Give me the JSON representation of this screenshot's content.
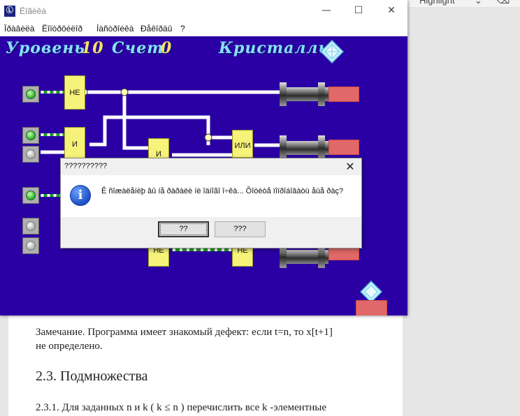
{
  "background_doc": {
    "toolbar_text": "Highlight",
    "note_line1": "Замечание. Программа имеет знакомый дефект: если t=n, то x[t+1]",
    "note_line2": "не определено.",
    "heading": "2.3. Подмножества",
    "para_start": "2.3.1. Для заданных n и k ( k ≤ n ) перечислить все k -элементные"
  },
  "window": {
    "title": "Ëîãèêà",
    "controls": {
      "minimize": "—",
      "maximize": "☐",
      "close": "✕"
    },
    "menu": [
      "Ïðàâèëà",
      "Ëîïòðôéëîð",
      "Íàñòðîéêà",
      "Ðåêîðäû",
      "?"
    ]
  },
  "game": {
    "level_label": "Уровень",
    "level_value": "10",
    "score_label": "Счет",
    "score_value": "0",
    "crystals_label": "Кристаллы",
    "gates": [
      "НЕ",
      "И",
      "И",
      "ИЛИ",
      "НЕ",
      "НЕ"
    ],
    "colors": {
      "background": "#2a00a5",
      "gate": "#f6f27a",
      "target": "#e06868",
      "lamp_on": "#28b028"
    }
  },
  "dialog": {
    "title": "??????????",
    "message": "Ê ñîæàëåíèþ âû íå ðàðàëè íè îäíîãî î÷êà... Õîòèòå ïîïðîáîâàòü åùå ðàç?",
    "yes_label": "??",
    "no_label": "???"
  }
}
